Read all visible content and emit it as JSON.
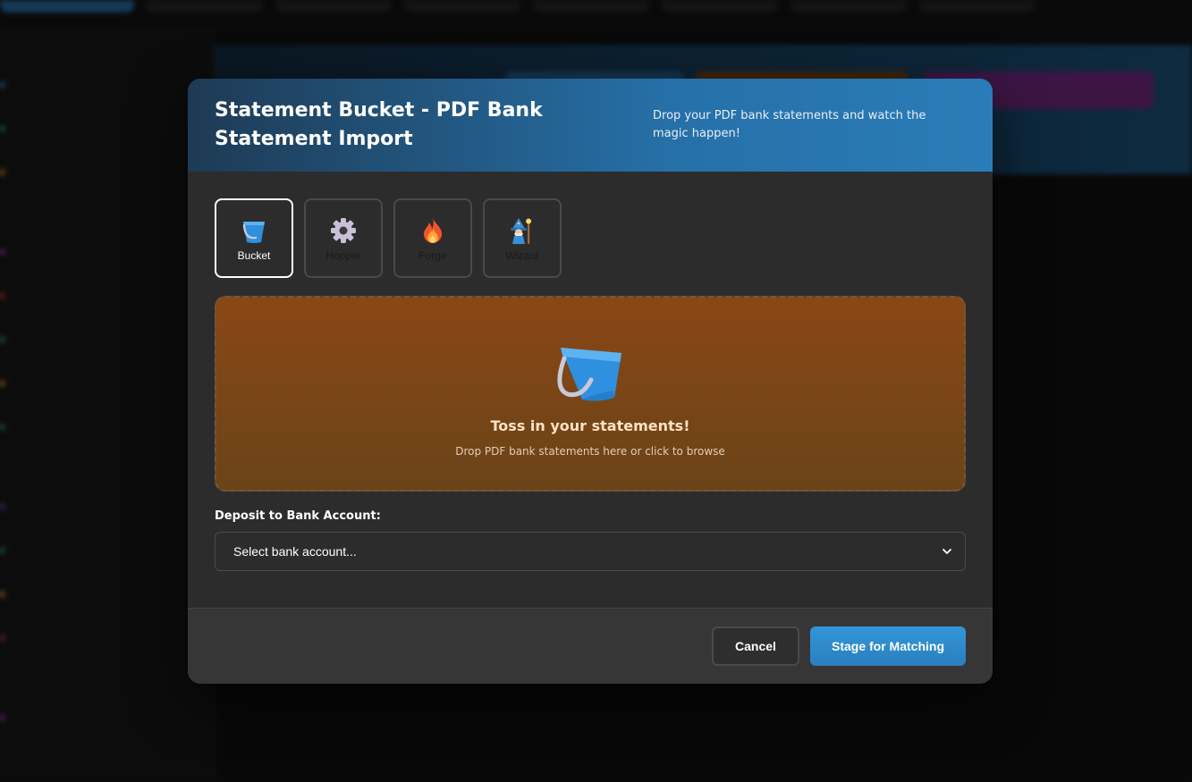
{
  "modal": {
    "title": "Statement Bucket - PDF Bank Statement Import",
    "subtitle": "Drop your PDF bank statements and watch the magic happen!",
    "modes": [
      {
        "label": "Bucket",
        "icon": "bucket-icon",
        "active": true
      },
      {
        "label": "Hopper",
        "icon": "gear-icon",
        "active": false
      },
      {
        "label": "Forge",
        "icon": "fire-icon",
        "active": false
      },
      {
        "label": "Wizard",
        "icon": "wizard-icon",
        "active": false
      }
    ],
    "dropzone": {
      "icon": "bucket-icon",
      "title": "Toss in your statements!",
      "hint": "Drop PDF bank statements here or click to browse"
    },
    "bank_field": {
      "label": "Deposit to Bank Account:",
      "selected": "Select bank account..."
    },
    "footer": {
      "cancel_label": "Cancel",
      "primary_label": "Stage for Matching"
    }
  },
  "colors": {
    "header_gradient_start": "#1e3a54",
    "header_gradient_end": "#2a7cb8",
    "dropzone_top": "#8a4715",
    "dropzone_bottom": "#6a4418",
    "primary_button": "#3396d8"
  }
}
